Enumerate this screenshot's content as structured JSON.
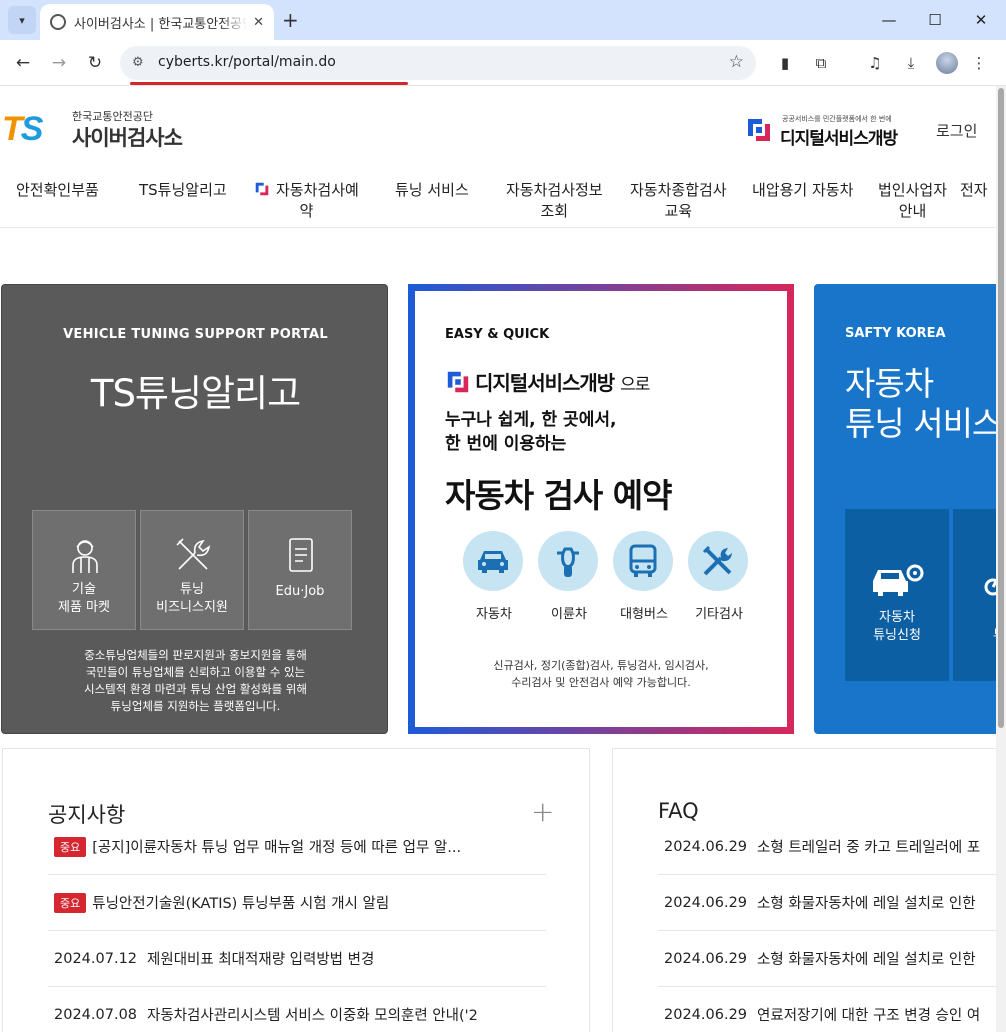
{
  "browser": {
    "tab_title": "사이버검사소 | 한국교통안전공단",
    "url": "cyberts.kr/portal/main.do"
  },
  "header": {
    "logo_mark": "TS",
    "logo_sub": "한국교통안전공단",
    "logo_main": "사이버검사소",
    "ds_tagline": "공공서비스를 민간플랫폼에서 한 번에",
    "ds_name": "디지털서비스개방",
    "login": "로그인"
  },
  "gnb": [
    "안전확인부품",
    "TS튜닝알리고",
    "자동차검사예",
    "약",
    "튜닝 서비스",
    "자동차검사정보",
    "조회",
    "자동차종합검사",
    "교육",
    "내압용기 자동차",
    "법인사업자",
    "안내",
    "전자"
  ],
  "card_tuning": {
    "tag": "VEHICLE TUNING SUPPORT PORTAL",
    "title": "TS튜닝알리고",
    "tiles": [
      {
        "l1": "기술",
        "l2": "제품 마켓"
      },
      {
        "l1": "튜닝",
        "l2": "비즈니스지원"
      },
      {
        "l1": "Edu·Job",
        "l2": ""
      }
    ],
    "desc": [
      "중소튜닝업체들의 판로지원과 홍보지원을 통해",
      "국민들이 튜닝업체를 신뢰하고 이용할 수 있는",
      "시스템적 환경 마련과 튜닝 산업 활성화를 위해",
      "튜닝업체를 지원하는 플랫폼입니다."
    ]
  },
  "card_inspection": {
    "tag": "EASY & QUICK",
    "ds_name": "디지털서비스개방",
    "ds_suffix": "으로",
    "line1": "누구나 쉽게, 한 곳에서,",
    "line2": "한 번에 이용하는",
    "title": "자동차 검사 예약",
    "services": [
      "자동차",
      "이륜차",
      "대형버스",
      "기타검사"
    ],
    "desc": [
      "신규검사, 정기(종합)검사, 튜닝검사, 임시검사,",
      "수리검사 및 안전검사 예약 가능합니다."
    ]
  },
  "card_safety": {
    "tag": "SAFTY KOREA",
    "title1": "자동차",
    "title2": "튜닝 서비스",
    "tiles": [
      {
        "l1": "자동차",
        "l2": "튜닝신청"
      },
      {
        "l1": "이",
        "l2": "튜닝"
      }
    ]
  },
  "notice": {
    "title": "공지사항",
    "badge": "중요",
    "items": [
      {
        "important": true,
        "text": "[공지]이륜자동차 튜닝 업무 매뉴얼 개정 등에 따른 업무 알..."
      },
      {
        "important": true,
        "text": "튜닝안전기술원(KATIS) 튜닝부품 시험 개시 알림"
      },
      {
        "date": "2024.07.12",
        "text": "제원대비표 최대적재량 입력방법 변경"
      },
      {
        "date": "2024.07.08",
        "text": "자동차검사관리시스템 서비스 이중화 모의훈련 안내('2"
      }
    ]
  },
  "faq": {
    "title": "FAQ",
    "items": [
      {
        "date": "2024.06.29",
        "text": "소형 트레일러 중 카고 트레일러에 포"
      },
      {
        "date": "2024.06.29",
        "text": "소형 화물자동차에 레일 설치로 인한"
      },
      {
        "date": "2024.06.29",
        "text": "소형 화물자동차에 레일 설치로 인한"
      },
      {
        "date": "2024.06.29",
        "text": "연료저장기에 대한 구조 변경 승인 여"
      }
    ]
  },
  "colors": {
    "accent_red": "#d6262f",
    "blue": "#1875c9",
    "gray_card": "#5a5a5a"
  }
}
